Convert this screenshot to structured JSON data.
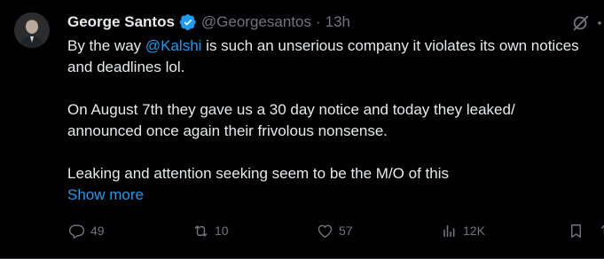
{
  "tweet": {
    "author_name": "George Santos",
    "handle": "@Georgesantos",
    "separator": "·",
    "time": "13h",
    "paragraph1_before": "By the way ",
    "paragraph1_mention": "@Kalshi",
    "paragraph1_after": " is such an unserious company it violates its own notices and deadlines lol.",
    "paragraph2": "On August 7th they gave us a 30 day notice and today they leaked/ announced once again their frivolous nonsense.",
    "paragraph3": "Leaking and attention seeking seem to be the M/O of this",
    "show_more": "Show more"
  },
  "actions": {
    "replies": "49",
    "reposts": "10",
    "likes": "57",
    "views": "12K"
  },
  "colors": {
    "background": "#000000",
    "text": "#e7e9ea",
    "muted": "#71767b",
    "accent": "#1d9bf0"
  },
  "icons": {
    "verified": "verified-badge-icon",
    "grok": "grok-icon",
    "more": "more-options-icon",
    "reply": "reply-icon",
    "repost": "repost-icon",
    "like": "like-icon",
    "views": "views-icon",
    "bookmark": "bookmark-icon"
  }
}
